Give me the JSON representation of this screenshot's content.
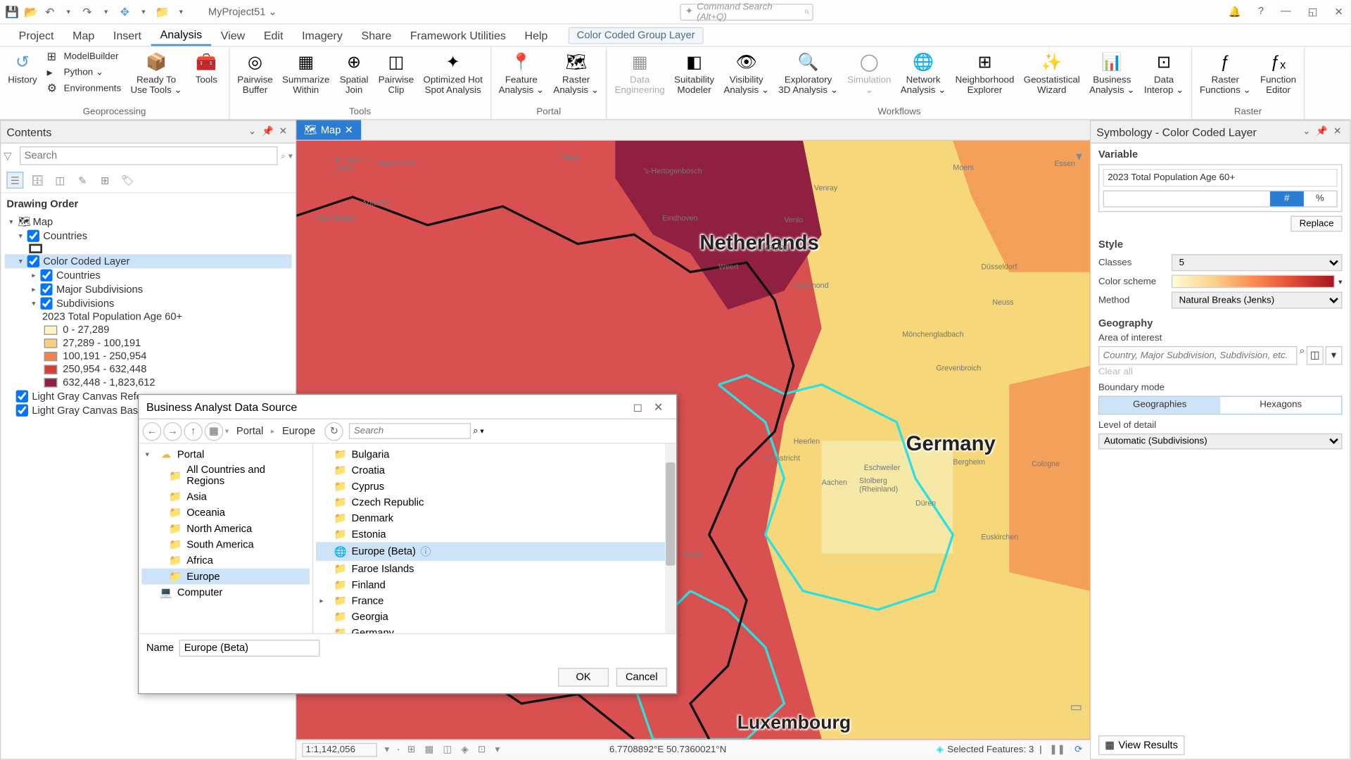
{
  "project_name": "MyProject51 ⌄",
  "command_search_placeholder": "Command Search (Alt+Q)",
  "menu_tabs": [
    "Project",
    "Map",
    "Insert",
    "Analysis",
    "View",
    "Edit",
    "Imagery",
    "Share",
    "Framework Utilities",
    "Help"
  ],
  "menu_active_index": 3,
  "context_tab_label": "Color Coded Group Layer",
  "ribbon": {
    "groups": [
      {
        "label": "Geoprocessing",
        "big": [
          {
            "name": "history",
            "icon": "↺",
            "text": "History"
          }
        ],
        "small": [
          {
            "name": "modelbuilder",
            "icon": "⊞",
            "text": "ModelBuilder"
          },
          {
            "name": "python",
            "icon": "▸",
            "text": "Python ⌄"
          },
          {
            "name": "environments",
            "icon": "⚙",
            "text": "Environments"
          }
        ],
        "big2": [
          {
            "name": "ready-tools",
            "icon": "📦",
            "text": "Ready To\nUse Tools ⌄"
          },
          {
            "name": "tools",
            "icon": "🧰",
            "text": "Tools"
          }
        ]
      },
      {
        "label": "Tools",
        "big": [
          {
            "name": "pairwise-buffer",
            "icon": "◎",
            "text": "Pairwise\nBuffer"
          },
          {
            "name": "summarize-within",
            "icon": "▦",
            "text": "Summarize\nWithin"
          },
          {
            "name": "spatial-join",
            "icon": "⊕",
            "text": "Spatial\nJoin"
          },
          {
            "name": "pairwise-clip",
            "icon": "◫",
            "text": "Pairwise\nClip"
          },
          {
            "name": "hotspot",
            "icon": "✦",
            "text": "Optimized Hot\nSpot Analysis"
          }
        ]
      },
      {
        "label": "Portal",
        "big": [
          {
            "name": "feature-analysis",
            "icon": "📍",
            "text": "Feature\nAnalysis ⌄"
          },
          {
            "name": "raster-analysis",
            "icon": "🗺",
            "text": "Raster\nAnalysis ⌄"
          }
        ]
      },
      {
        "label": "Workflows",
        "big": [
          {
            "name": "data-engineering",
            "icon": "▦",
            "text": "Data\nEngineering",
            "disabled": true
          },
          {
            "name": "suitability",
            "icon": "◧",
            "text": "Suitability\nModeler"
          },
          {
            "name": "visibility",
            "icon": "👁",
            "text": "Visibility\nAnalysis ⌄"
          },
          {
            "name": "exploratory-3d",
            "icon": "🔍",
            "text": "Exploratory\n3D Analysis ⌄"
          },
          {
            "name": "simulation",
            "icon": "◯",
            "text": "Simulation\n⌄",
            "disabled": true
          },
          {
            "name": "network",
            "icon": "🌐",
            "text": "Network\nAnalysis ⌄"
          },
          {
            "name": "neighborhood",
            "icon": "⊞",
            "text": "Neighborhood\nExplorer"
          },
          {
            "name": "geostatistical",
            "icon": "✨",
            "text": "Geostatistical\nWizard"
          },
          {
            "name": "business",
            "icon": "📊",
            "text": "Business\nAnalysis ⌄"
          },
          {
            "name": "data-interop",
            "icon": "⊡",
            "text": "Data\nInterop ⌄"
          }
        ]
      },
      {
        "label": "Raster",
        "big": [
          {
            "name": "raster-functions",
            "icon": "ƒ",
            "text": "Raster\nFunctions ⌄"
          },
          {
            "name": "function-editor",
            "icon": "ƒₓ",
            "text": "Function\nEditor"
          }
        ]
      }
    ]
  },
  "contents": {
    "title": "Contents",
    "search_placeholder": "Search",
    "drawing_order": "Drawing Order",
    "map_root": "Map",
    "layers": {
      "countries": "Countries",
      "ccl": "Color Coded Layer",
      "ccl_countries": "Countries",
      "ccl_major": "Major Subdivisions",
      "ccl_sub": "Subdivisions",
      "variable": "2023 Total Population Age 60+",
      "legend": [
        {
          "color": "#fdf4c4",
          "label": "0 - 27,289"
        },
        {
          "color": "#fccf80",
          "label": "27,289 - 100,191"
        },
        {
          "color": "#f3834a",
          "label": "100,191 - 250,954"
        },
        {
          "color": "#d6403a",
          "label": "250,954 - 632,448"
        },
        {
          "color": "#902042",
          "label": "632,448 - 1,823,612"
        }
      ],
      "ref": "Light Gray Canvas Reference",
      "base": "Light Gray Canvas Base"
    }
  },
  "map": {
    "tab_label": "Map",
    "labels": {
      "netherlands": "Netherlands",
      "germany": "Germany",
      "luxembourg": "Luxembourg"
    },
    "small_labels": {
      "antwerp": "Antwerp",
      "tilburg": "Tilburg",
      "s_hertogenbosch": "'s-Hertogenbosch",
      "helmond": "Helmond",
      "eindhoven": "Eindhoven",
      "roermond": "Roermond",
      "weert": "Weert",
      "limburg": "LIMBURG",
      "venlo": "Venlo",
      "moers": "Moers",
      "essen": "Essen",
      "dusseldorf": "Düsseldorf",
      "neuss": "Neuss",
      "grevenbroich": "Grevenbroich",
      "monchengladbach": "Mönchengladbach",
      "bergheim": "Bergheim",
      "cologne": "Cologne",
      "aachen": "Aachen",
      "duren": "Düren",
      "stolberg": "Stolberg\n(Rheinland)",
      "eschweiler": "Eschweiler",
      "liege": "Liège",
      "heerlen": "Heerlen",
      "euskirchen": "Euskirchen",
      "maastricht": "Maastricht",
      "roosendaal": "Roosendaal",
      "sint_niklaas": "Sint-Niklaas",
      "bergen_op_zoom": "Bergen op\nZoom",
      "venray": "Venray"
    },
    "scale": "1:1,142,056",
    "coords": "6.7708892°E 50.7360021°N",
    "selected_features": "Selected Features: 3"
  },
  "symbology": {
    "title": "Symbology - Color Coded Layer",
    "h_variable": "Variable",
    "variable_value": "2023 Total Population Age 60+",
    "pill_num": "#",
    "pill_pct": "%",
    "replace": "Replace",
    "h_style": "Style",
    "classes_label": "Classes",
    "classes_value": "5",
    "colorscheme_label": "Color scheme",
    "method_label": "Method",
    "method_value": "Natural Breaks (Jenks)",
    "h_geography": "Geography",
    "aoi_label": "Area of interest",
    "aoi_placeholder": "Country, Major Subdivision, Subdivision, etc.",
    "clear_all": "Clear all",
    "boundary_label": "Boundary mode",
    "boundary_geo": "Geographies",
    "boundary_hex": "Hexagons",
    "lod_label": "Level of detail",
    "lod_value": "Automatic (Subdivisions)",
    "view_results": "View Results"
  },
  "dialog": {
    "title": "Business Analyst Data Source",
    "crumb1": "Portal",
    "crumb2": "Europe",
    "search_placeholder": "Search",
    "left_tree": [
      {
        "level": 0,
        "arrow": "▾",
        "icon": "☁",
        "label": "Portal",
        "name": "portal"
      },
      {
        "level": 1,
        "icon": "📁",
        "label": "All Countries and Regions",
        "name": "all-countries"
      },
      {
        "level": 1,
        "icon": "📁",
        "label": "Asia",
        "name": "asia"
      },
      {
        "level": 1,
        "icon": "📁",
        "label": "Oceania",
        "name": "oceania"
      },
      {
        "level": 1,
        "icon": "📁",
        "label": "North America",
        "name": "north-america"
      },
      {
        "level": 1,
        "icon": "📁",
        "label": "South America",
        "name": "south-america"
      },
      {
        "level": 1,
        "icon": "📁",
        "label": "Africa",
        "name": "africa"
      },
      {
        "level": 1,
        "icon": "📁",
        "label": "Europe",
        "name": "europe",
        "selected": true
      },
      {
        "level": 0,
        "icon": "💻",
        "label": "Computer",
        "name": "computer"
      }
    ],
    "right_list": [
      {
        "icon": "📁",
        "label": "Bulgaria"
      },
      {
        "icon": "📁",
        "label": "Croatia"
      },
      {
        "icon": "📁",
        "label": "Cyprus"
      },
      {
        "icon": "📁",
        "label": "Czech Republic"
      },
      {
        "icon": "📁",
        "label": "Denmark"
      },
      {
        "icon": "📁",
        "label": "Estonia"
      },
      {
        "icon": "🌐",
        "label": "Europe (Beta)",
        "selected": true,
        "info": true
      },
      {
        "icon": "📁",
        "label": "Faroe Islands"
      },
      {
        "icon": "📁",
        "label": "Finland"
      },
      {
        "icon": "📁",
        "label": "France",
        "expandable": true
      },
      {
        "icon": "📁",
        "label": "Georgia"
      },
      {
        "icon": "📁",
        "label": "Germany"
      }
    ],
    "name_label": "Name",
    "name_value": "Europe (Beta)",
    "ok": "OK",
    "cancel": "Cancel"
  }
}
